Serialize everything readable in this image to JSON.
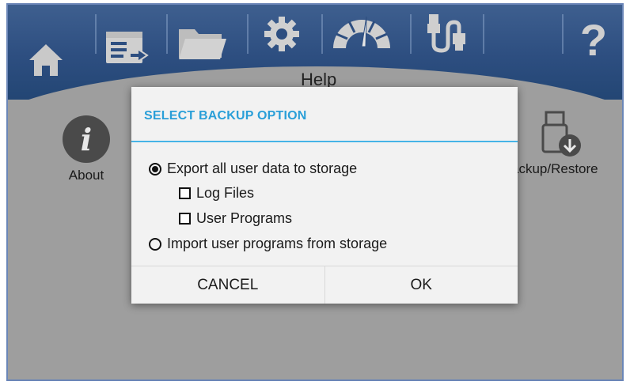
{
  "toolbar": {
    "icons": [
      "home-icon",
      "program-list-icon",
      "folder-icon",
      "gear-icon",
      "gauge-icon",
      "usb-cable-icon",
      "help-icon"
    ],
    "help_glyph": "?"
  },
  "page": {
    "title": "Help",
    "items": [
      {
        "label": "About",
        "icon": "info-icon",
        "glyph": "i"
      },
      {
        "label": "ackup/Restore",
        "icon": "usb-download-icon"
      }
    ]
  },
  "dialog": {
    "title": "SELECT BACKUP OPTION",
    "options": [
      {
        "label": "Export all user data to storage",
        "type": "radio",
        "selected": true
      },
      {
        "label": "Log Files",
        "type": "checkbox",
        "checked": false
      },
      {
        "label": "User Programs",
        "type": "checkbox",
        "checked": false
      },
      {
        "label": "Import user programs from storage",
        "type": "radio",
        "selected": false
      }
    ],
    "cancel_label": "CANCEL",
    "ok_label": "OK"
  },
  "colors": {
    "toolbar": "#2d4e80",
    "accent": "#2a9fd8",
    "background": "#9e9e9e",
    "dialog": "#f2f2f2"
  }
}
